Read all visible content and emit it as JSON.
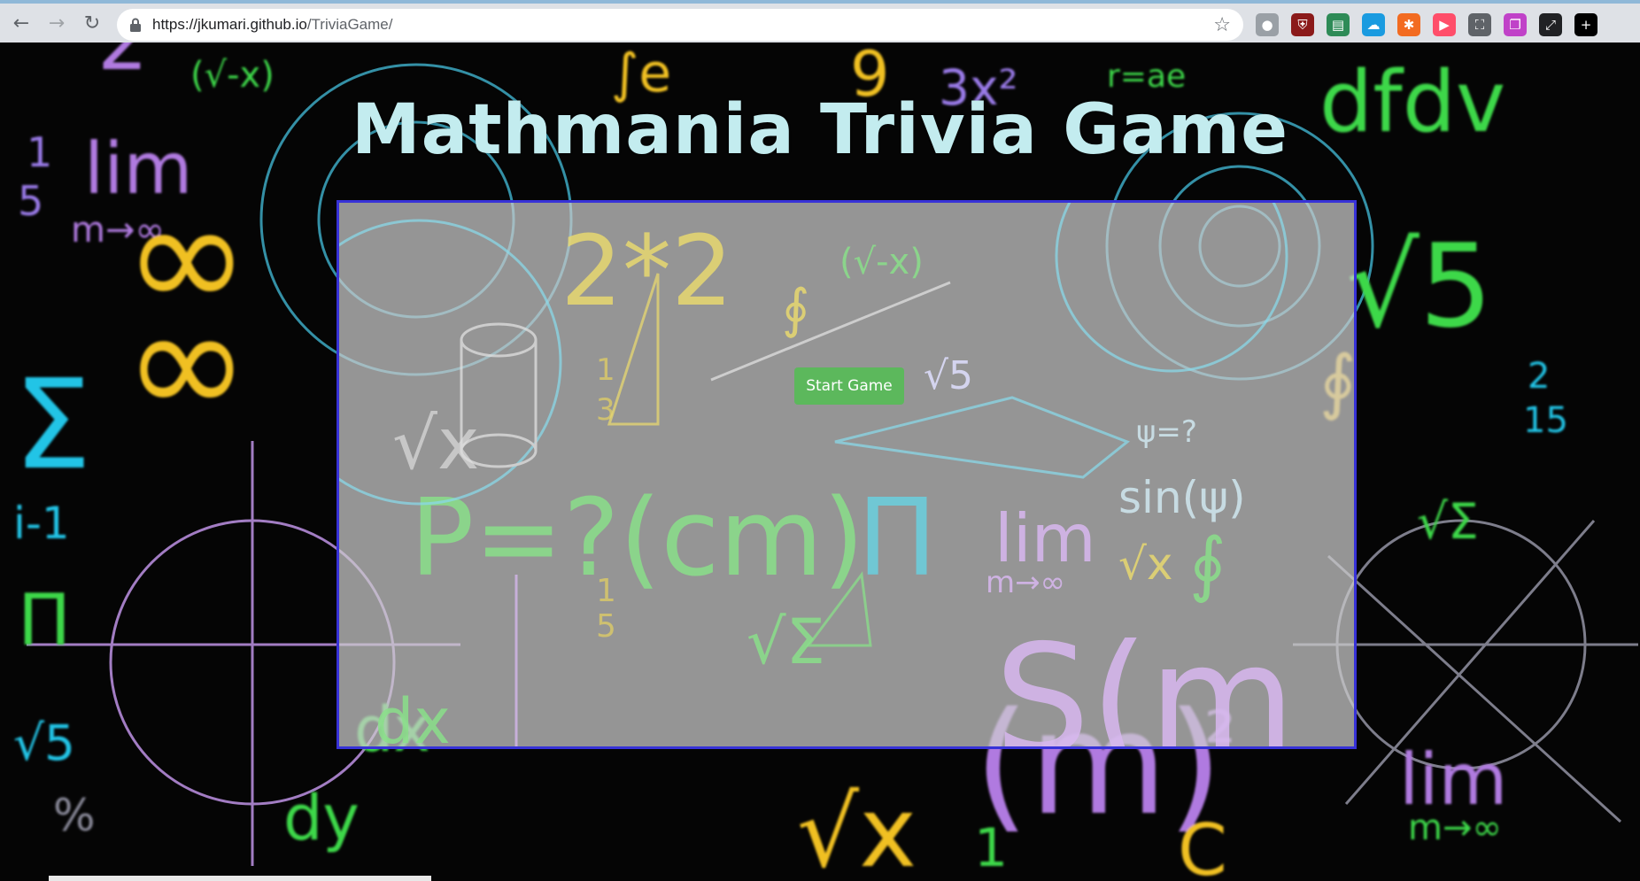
{
  "browser": {
    "url_host": "https://jkumari.github.io",
    "url_path": "/TriviaGame/",
    "extensions": [
      {
        "name": "circle-extension-icon",
        "color": "#9aa0a6",
        "glyph": "●"
      },
      {
        "name": "shield-extension-icon",
        "color": "#8b1a1a",
        "glyph": "⛨"
      },
      {
        "name": "print-extension-icon",
        "color": "#2e8b57",
        "glyph": "▤"
      },
      {
        "name": "cloud-extension-icon",
        "color": "#1a9be0",
        "glyph": "☁"
      },
      {
        "name": "hub-extension-icon",
        "color": "#f26b21",
        "glyph": "✱"
      },
      {
        "name": "video-extension-icon",
        "color": "#ff4e6a",
        "glyph": "▶"
      },
      {
        "name": "screenshot-extension-icon",
        "color": "#5f6368",
        "glyph": "⛶"
      },
      {
        "name": "window-extension-icon",
        "color": "#c042c8",
        "glyph": "❐"
      },
      {
        "name": "resize-extension-icon",
        "color": "#202124",
        "glyph": "⤢"
      },
      {
        "name": "plus-extension-icon",
        "color": "#000000",
        "glyph": "+"
      }
    ]
  },
  "page": {
    "title": "Mathmania Trivia Game",
    "start_button_label": "Start Game"
  },
  "colors": {
    "title": "#c3ecef",
    "box_border": "#3732d8",
    "start_button": "#5cb85c"
  }
}
